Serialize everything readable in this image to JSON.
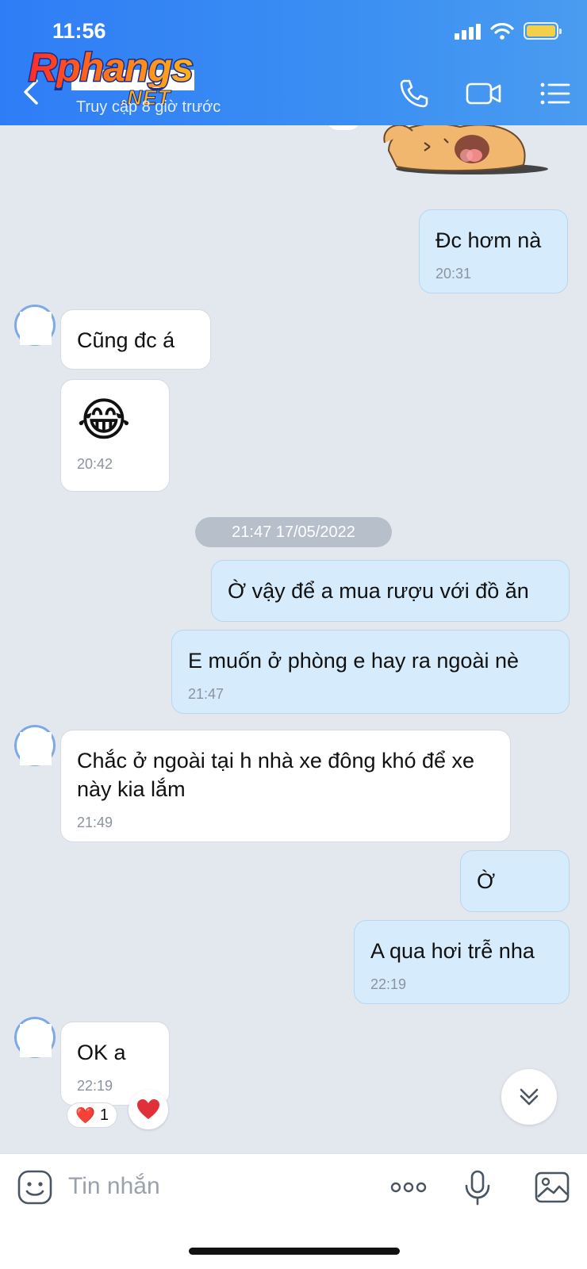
{
  "status_bar": {
    "time": "11:56"
  },
  "header": {
    "logo_main": "Rphangs",
    "logo_sub": ".NET",
    "last_seen": "Truy cập 8 giờ trước"
  },
  "messages": [
    {
      "id": "m1",
      "direction": "out",
      "text": "Đc hơm nà",
      "time": "20:31"
    },
    {
      "id": "m2",
      "direction": "in",
      "text": "Cũng đc á",
      "time": ""
    },
    {
      "id": "m3",
      "direction": "in",
      "emoji": "😂",
      "time": "20:42"
    },
    {
      "id": "m4",
      "direction": "out",
      "text": "Ờ vậy để a mua rượu với đồ ăn",
      "time": ""
    },
    {
      "id": "m5",
      "direction": "out",
      "text": "E muốn ở phòng e hay ra ngoài nè",
      "time": "21:47"
    },
    {
      "id": "m6",
      "direction": "in",
      "text": "Chắc ở ngoài tại h nhà xe đông khó để xe này kia lắm",
      "time": "21:49"
    },
    {
      "id": "m7",
      "direction": "out",
      "text": "Ờ",
      "time": ""
    },
    {
      "id": "m8",
      "direction": "out",
      "text": "A qua hơi trễ nha",
      "time": "22:19"
    },
    {
      "id": "m9",
      "direction": "in",
      "text": "OK a",
      "time": "22:19"
    }
  ],
  "date_separator": "21:47 17/05/2022",
  "reaction": {
    "emoji": "❤️",
    "count": "1"
  },
  "input": {
    "placeholder": "Tin nhắn"
  },
  "colors": {
    "header": "#3b8ff2",
    "outgoing_bubble": "#d6ecfd",
    "incoming_bubble": "#ffffff",
    "background": "#e3e7ee"
  },
  "icons": [
    "back-icon",
    "phone-icon",
    "video-call-icon",
    "menu-icon",
    "emoji-sticker-icon",
    "more-icon",
    "microphone-icon",
    "image-icon",
    "chevron-double-down-icon",
    "heart-icon"
  ]
}
